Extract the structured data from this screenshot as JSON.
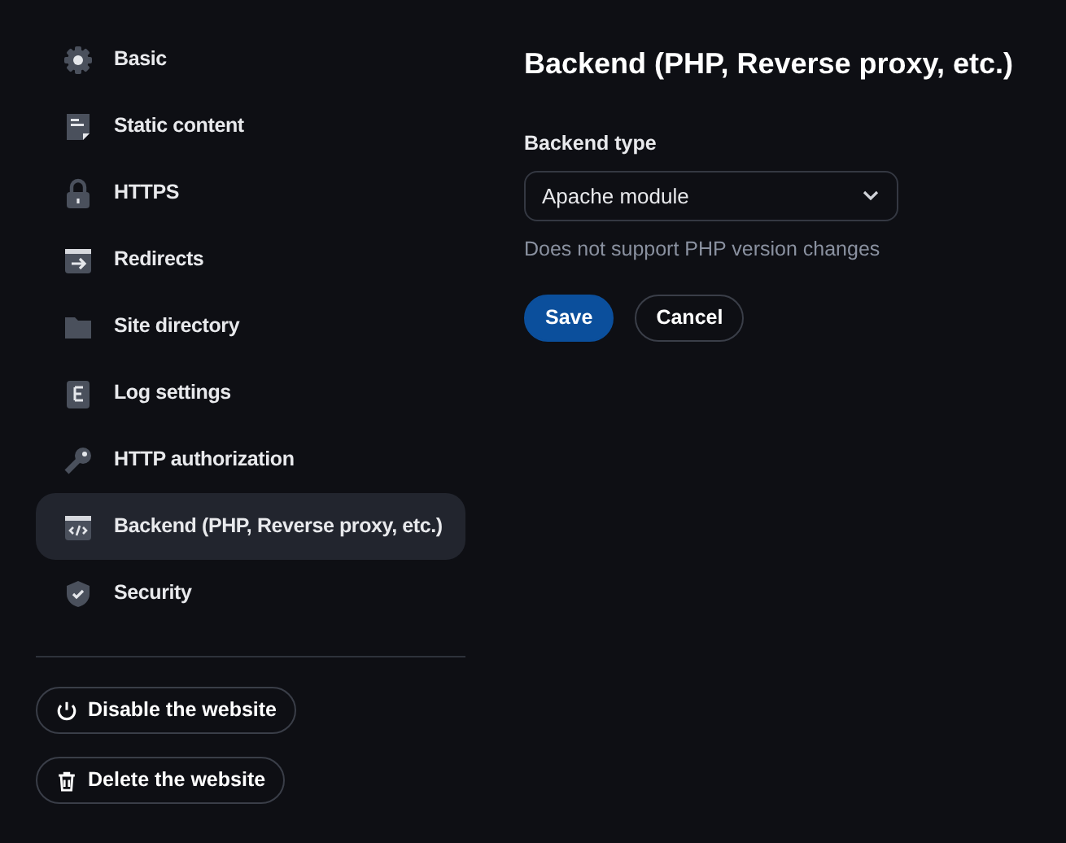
{
  "sidebar": {
    "items": [
      {
        "label": "Basic",
        "selected": false
      },
      {
        "label": "Static content",
        "selected": false
      },
      {
        "label": "HTTPS",
        "selected": false
      },
      {
        "label": "Redirects",
        "selected": false
      },
      {
        "label": "Site directory",
        "selected": false
      },
      {
        "label": "Log settings",
        "selected": false
      },
      {
        "label": "HTTP authorization",
        "selected": false
      },
      {
        "label": "Backend (PHP, Reverse proxy, etc.)",
        "selected": true
      },
      {
        "label": "Security",
        "selected": false
      }
    ],
    "actions": [
      {
        "kind": "power",
        "label": "Disable the website"
      },
      {
        "kind": "trash",
        "label": "Delete the website"
      }
    ]
  },
  "main": {
    "title": "Backend (PHP, Reverse proxy, etc.)",
    "field": {
      "label": "Backend type",
      "value": "Apache module",
      "hint": "Does not support PHP version changes"
    },
    "buttons": [
      {
        "kind": "primary",
        "label": "Save"
      },
      {
        "kind": "secondary",
        "label": "Cancel"
      }
    ]
  }
}
